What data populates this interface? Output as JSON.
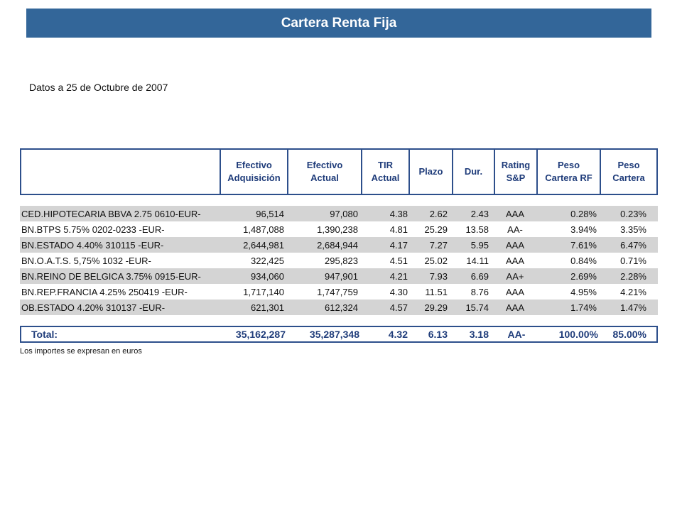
{
  "title": "Cartera Renta Fija",
  "date_line": "Datos a 25 de Octubre de 2007",
  "headers": [
    "Efectivo\nAdquisición",
    "Efectivo\nActual",
    "TIR\nActual",
    "Plazo",
    "Dur.",
    "Rating\nS&P",
    "Peso\nCartera RF",
    "Peso\nCartera"
  ],
  "rows": [
    {
      "name": "CED.HIPOTECARIA BBVA 2.75 0610-EUR-",
      "adq": "96,514",
      "act": "97,080",
      "tir": "4.38",
      "plazo": "2.62",
      "dur": "2.43",
      "rating": "AAA",
      "peso_rf": "0.28%",
      "peso": "0.23%"
    },
    {
      "name": "BN.BTPS 5.75% 0202-0233 -EUR-",
      "adq": "1,487,088",
      "act": "1,390,238",
      "tir": "4.81",
      "plazo": "25.29",
      "dur": "13.58",
      "rating": "AA-",
      "peso_rf": "3.94%",
      "peso": "3.35%"
    },
    {
      "name": "BN.ESTADO 4.40% 310115 -EUR-",
      "adq": "2,644,981",
      "act": "2,684,944",
      "tir": "4.17",
      "plazo": "7.27",
      "dur": "5.95",
      "rating": "AAA",
      "peso_rf": "7.61%",
      "peso": "6.47%"
    },
    {
      "name": "BN.O.A.T.S. 5,75% 1032 -EUR-",
      "adq": "322,425",
      "act": "295,823",
      "tir": "4.51",
      "plazo": "25.02",
      "dur": "14.11",
      "rating": "AAA",
      "peso_rf": "0.84%",
      "peso": "0.71%"
    },
    {
      "name": "BN.REINO DE BELGICA 3.75% 0915-EUR-",
      "adq": "934,060",
      "act": "947,901",
      "tir": "4.21",
      "plazo": "7.93",
      "dur": "6.69",
      "rating": "AA+",
      "peso_rf": "2.69%",
      "peso": "2.28%"
    },
    {
      "name": "BN.REP.FRANCIA 4.25% 250419 -EUR-",
      "adq": "1,717,140",
      "act": "1,747,759",
      "tir": "4.30",
      "plazo": "11.51",
      "dur": "8.76",
      "rating": "AAA",
      "peso_rf": "4.95%",
      "peso": "4.21%"
    },
    {
      "name": "OB.ESTADO 4.20% 310137 -EUR-",
      "adq": "621,301",
      "act": "612,324",
      "tir": "4.57",
      "plazo": "29.29",
      "dur": "15.74",
      "rating": "AAA",
      "peso_rf": "1.74%",
      "peso": "1.47%"
    }
  ],
  "total": {
    "label": "Total:",
    "adq": "35,162,287",
    "act": "35,287,348",
    "tir": "4.32",
    "plazo": "6.13",
    "dur": "3.18",
    "rating": "AA-",
    "peso_rf": "100.00%",
    "peso": "85.00%"
  },
  "footnote": "Los importes se expresan en euros",
  "colors": {
    "title_bar": "#336699",
    "header_text": "#1f3c7a",
    "border": "#2d4f8b",
    "row_shade": "#d4d4d4"
  }
}
